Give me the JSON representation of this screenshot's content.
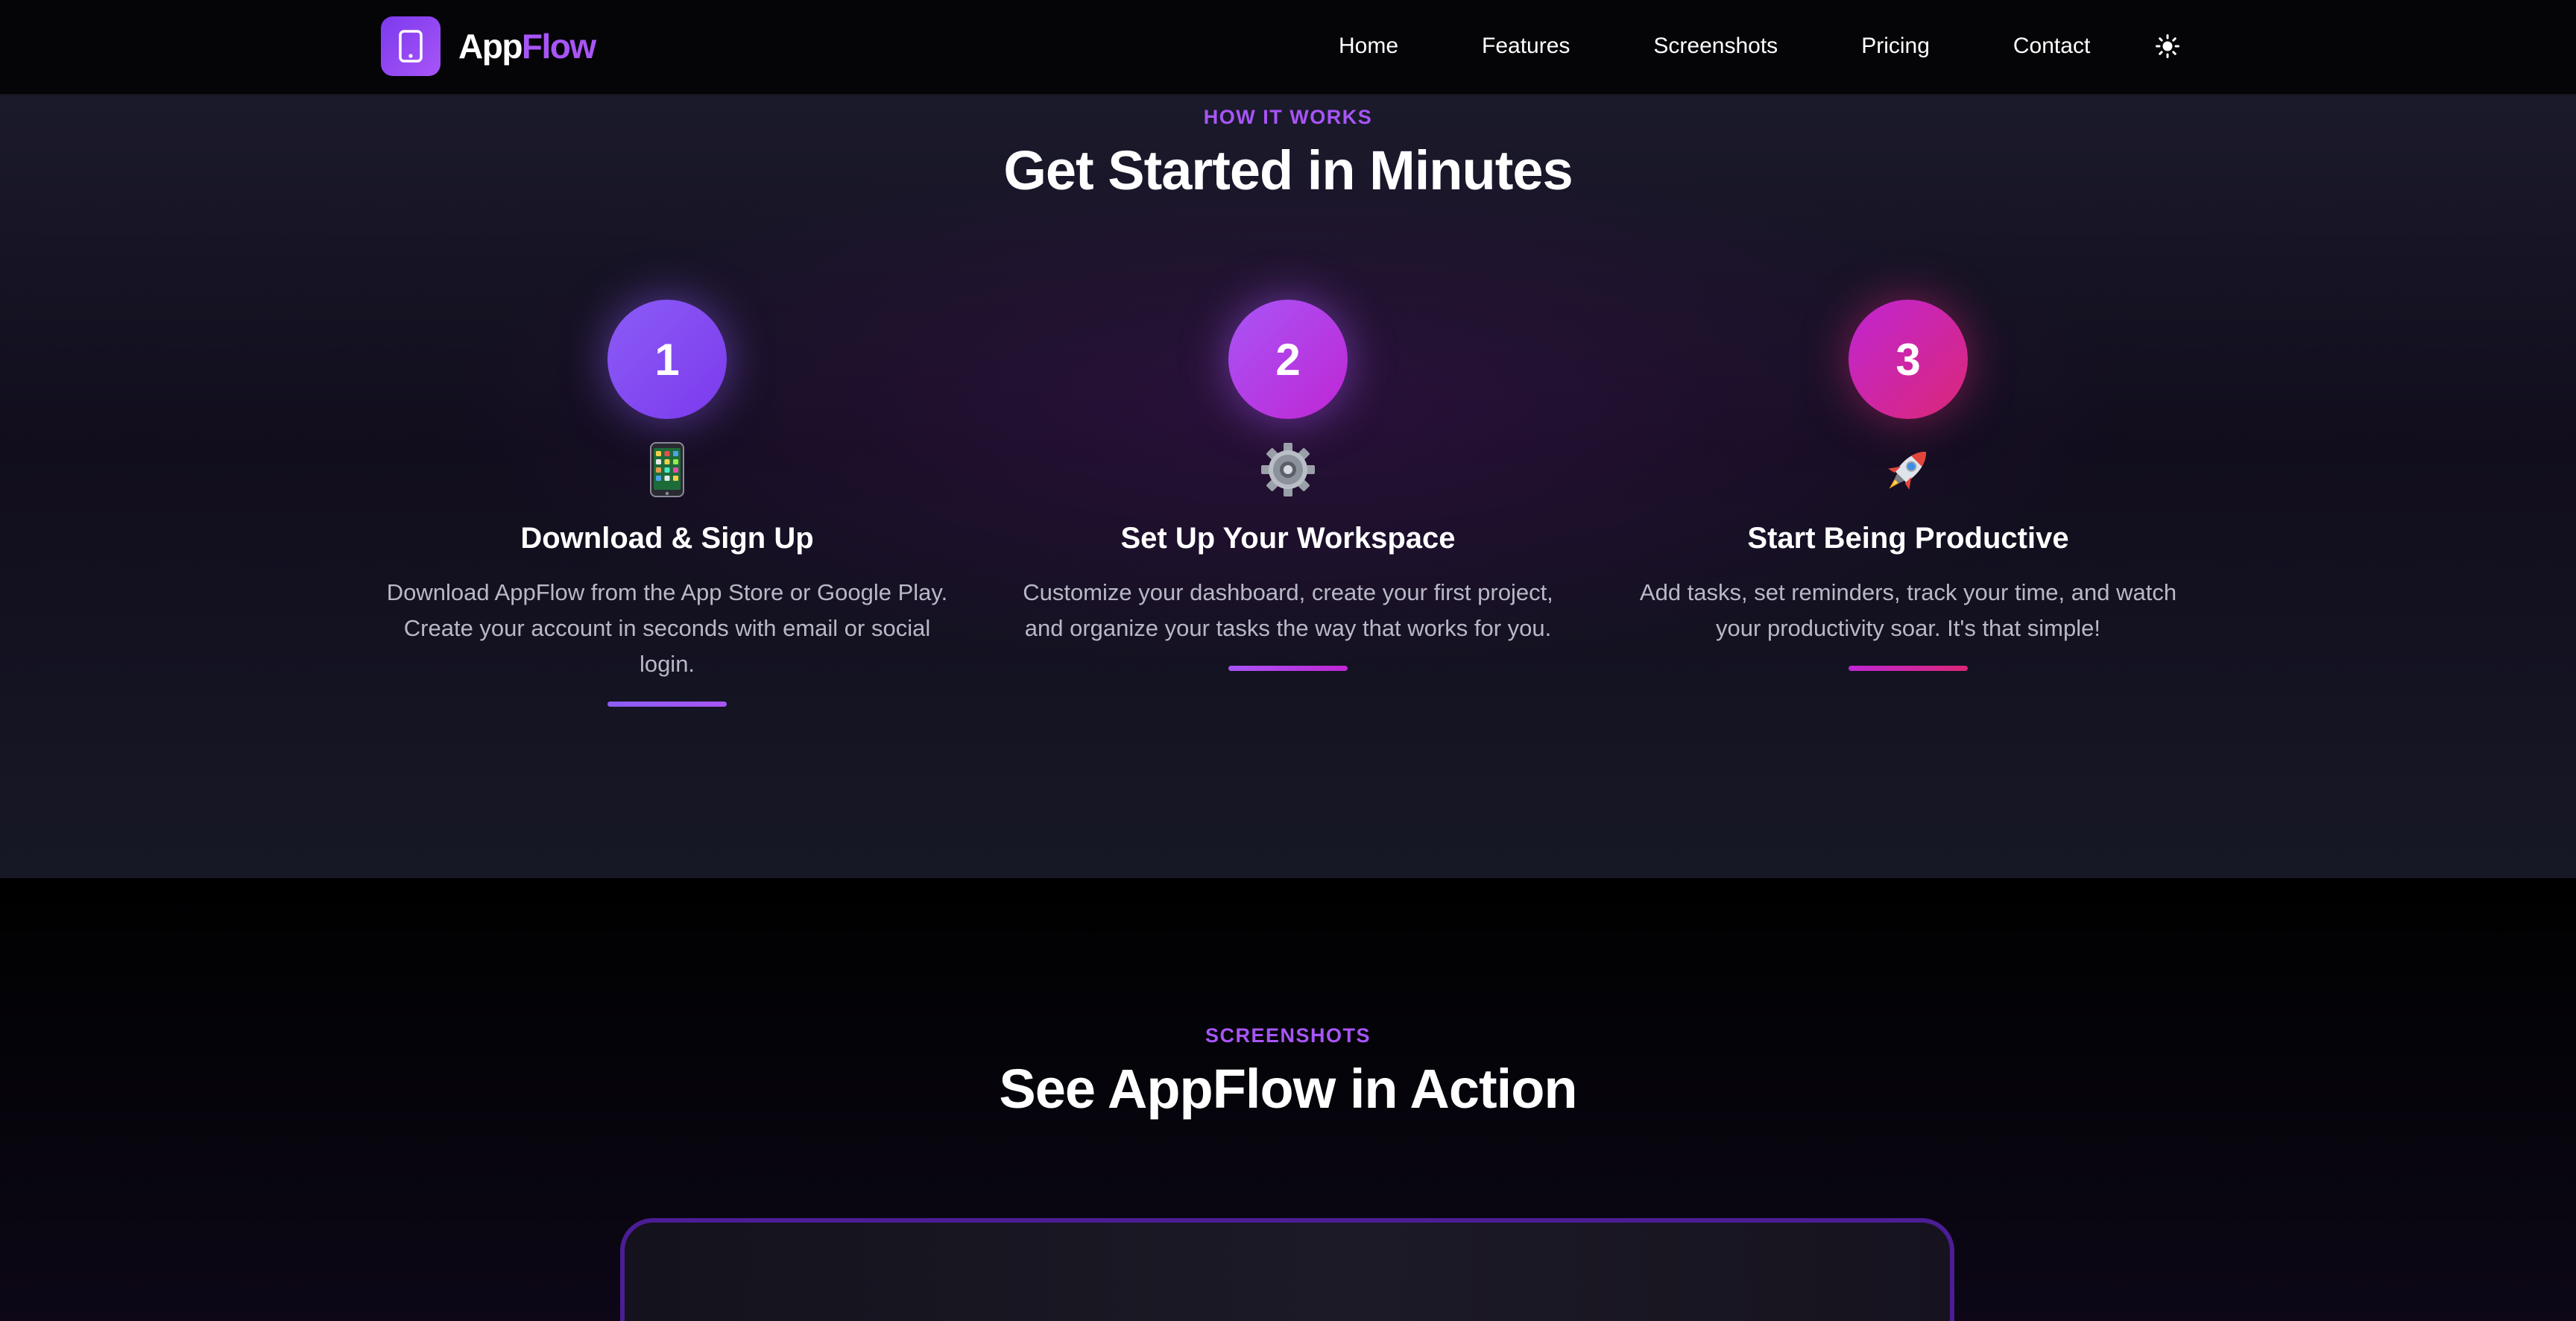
{
  "brand": {
    "name_part1": "App",
    "name_part2": "Flow",
    "logo_icon": "phone-icon",
    "accent_color": "#a855f7"
  },
  "nav": {
    "links": [
      "Home",
      "Features",
      "Screenshots",
      "Pricing",
      "Contact"
    ],
    "theme_toggle_icon": "sun-icon"
  },
  "how_it_works": {
    "eyebrow": "HOW IT WORKS",
    "title": "Get Started in Minutes",
    "steps": [
      {
        "number": "1",
        "icon": "mobile-phone-icon",
        "heading": "Download & Sign Up",
        "description": "Download AppFlow from the App Store or Google Play. Create your account in seconds with email or social login."
      },
      {
        "number": "2",
        "icon": "gear-icon",
        "heading": "Set Up Your Workspace",
        "description": "Customize your dashboard, create your first project, and organize your tasks the way that works for you."
      },
      {
        "number": "3",
        "icon": "rocket-icon",
        "heading": "Start Being Productive",
        "description": "Add tasks, set reminders, track your time, and watch your productivity soar. It's that simple!"
      }
    ]
  },
  "screenshots": {
    "eyebrow": "SCREENSHOTS",
    "title": "See AppFlow in Action"
  }
}
